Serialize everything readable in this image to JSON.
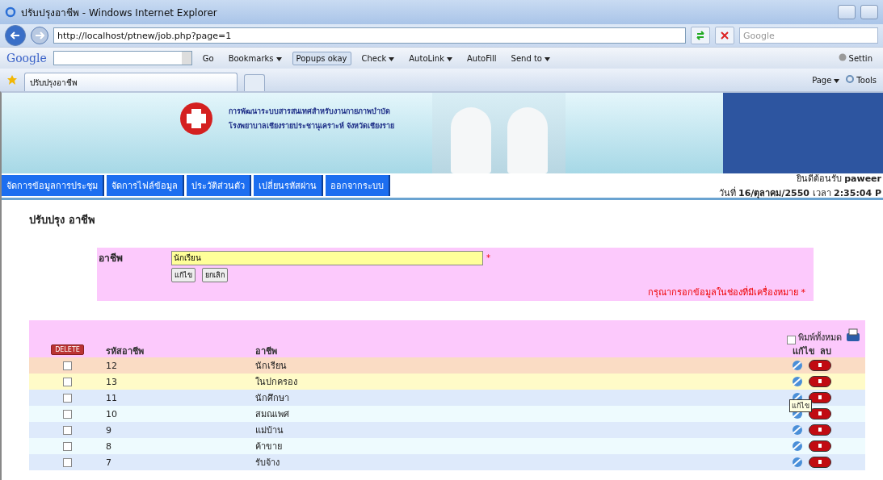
{
  "window": {
    "title": "ปรับปรุงอาชีพ - Windows Internet Explorer"
  },
  "address_bar": {
    "url": "http://localhost/ptnew/job.php?page=1",
    "search_placeholder": "Google"
  },
  "google_toolbar": {
    "logo": "Google",
    "go": "Go",
    "items": [
      {
        "label": "Bookmarks",
        "kind": "menu",
        "selected": false
      },
      {
        "label": "Popups okay",
        "kind": "button",
        "selected": true
      },
      {
        "label": "Check",
        "kind": "menu",
        "selected": false
      },
      {
        "label": "AutoLink",
        "kind": "menu",
        "selected": false
      },
      {
        "label": "AutoFill",
        "kind": "button",
        "selected": false
      },
      {
        "label": "Send to",
        "kind": "menu",
        "selected": false
      }
    ],
    "settings": "Settin"
  },
  "tabs": [
    {
      "label": "ปรับปรุงอาชีพ",
      "selected": true
    }
  ],
  "command_bar": {
    "page": "Page",
    "tools": "Tools"
  },
  "banner": {
    "lines": [
      "การพัฒนาระบบสารสนเทศสำหรับงานกายภาพบำบัด",
      "โรงพยาบาลเชียงรายประชานุเคราะห์  จังหวัดเชียงราย"
    ]
  },
  "nav": [
    "จัดการข้อมูลการประชุม",
    "จัดการไฟล์ข้อมูล",
    "ประวัติส่วนตัว",
    "เปลี่ยนรหัสผ่าน",
    "ออกจากระบบ"
  ],
  "welcome": {
    "greeting": "ยินดีต้อนรับ **paweer**",
    "datetime": "วันที่ **16/ตุลาคม/2550** เวลา **2:35:04 P**"
  },
  "page_title": "ปรับปรุง อาชีพ",
  "form": {
    "label": "อาชีพ",
    "value": "นักเรียน",
    "required_mark": "*",
    "buttons": [
      "แก้ไข",
      "ยกเลิก"
    ],
    "note": "กรุณากรอกข้อมูลในช่องที่มีเครื่องหมาย *"
  },
  "table": {
    "print_all": {
      "label": "พิมพ์ทั้งหมด",
      "checked": false
    },
    "delete_button": "DELETE",
    "columns": [
      "รหัสอาชีพ",
      "อาชีพ",
      "แก้ไข",
      "ลบ"
    ],
    "rows": [
      {
        "code": "12",
        "name": "นักเรียน",
        "checked": false,
        "color": "#fadcc4"
      },
      {
        "code": "13",
        "name": "ในปกครอง",
        "checked": false,
        "color": "#fffbc8"
      },
      {
        "code": "11",
        "name": "นักศึกษา",
        "checked": false,
        "color": "#deeafb",
        "tooltip": "แก้ไข"
      },
      {
        "code": "10",
        "name": "สมณเพศ",
        "checked": false,
        "color": "#eefbfe"
      },
      {
        "code": "9",
        "name": "แม่บ้าน",
        "checked": false,
        "color": "#deeafb"
      },
      {
        "code": "8",
        "name": "ค้าขาย",
        "checked": false,
        "color": "#eefbfe"
      },
      {
        "code": "7",
        "name": "รับจ้าง",
        "checked": false,
        "color": "#deeafb"
      }
    ]
  }
}
